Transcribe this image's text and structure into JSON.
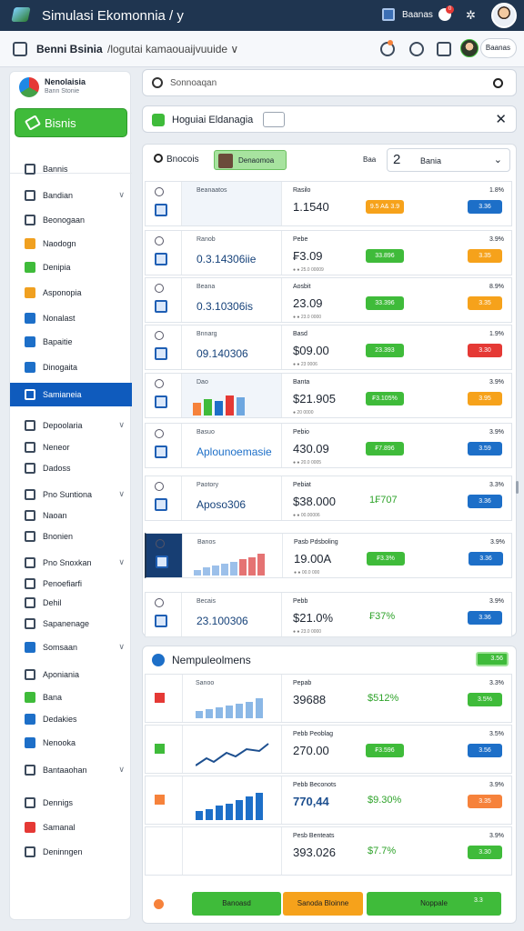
{
  "titlebar": {
    "title": "Simulasi Ekomonnia / y",
    "account_label": "Baanas",
    "badge_count": "0"
  },
  "toolbar": {
    "crumb_main": "Benni Bsinia",
    "crumb_path": "/logutai kamaouaijvuuide  ∨",
    "user_pill": "Baanas"
  },
  "sidebar": {
    "org_name": "Nenolaisia",
    "org_sub": "Bann Stonie",
    "primary_button": "Bisnis",
    "items": [
      {
        "label": "Bannis",
        "icon": "doc-icon",
        "color": "#3c4a5c"
      },
      {
        "label": "Bandian",
        "icon": "doc-icon",
        "color": "#3c4a5c",
        "chevron": "∨"
      },
      {
        "label": "Beonogaan",
        "icon": "doc-icon",
        "color": "#3c4a5c"
      },
      {
        "label": "Naodogn",
        "icon": "folder-icon",
        "color": "#f0a020"
      },
      {
        "label": "Denipia",
        "icon": "box-icon",
        "color": "#3fbb3a"
      },
      {
        "label": "Asponopia",
        "icon": "coin-icon",
        "color": "#f0a020"
      },
      {
        "label": "Nonalast",
        "icon": "check-icon",
        "color": "#1d6fc8"
      },
      {
        "label": "Bapaitie",
        "icon": "calendar-icon",
        "color": "#1d6fc8"
      },
      {
        "label": "Dinogaita",
        "icon": "edit-icon",
        "color": "#1d6fc8"
      },
      {
        "label": "Samianeia",
        "icon": "window-icon",
        "color": "#ffffff",
        "active": true
      },
      {
        "label": "Depoolaria",
        "icon": "doc-icon",
        "color": "#3c4a5c",
        "chevron": "∨"
      },
      {
        "label": "Neneor",
        "icon": "doc-icon",
        "color": "#3c4a5c"
      },
      {
        "label": "Dadoss",
        "icon": "doc-icon",
        "color": "#3c4a5c"
      },
      {
        "label": "Pno Suntiona",
        "icon": "doc-icon",
        "color": "#3c4a5c",
        "chevron": "∨"
      },
      {
        "label": "Naoan",
        "icon": "doc-icon",
        "color": "#3c4a5c"
      },
      {
        "label": "Bnonien",
        "icon": "chart-icon",
        "color": "#3c4a5c"
      },
      {
        "label": "Pno Snoxkan",
        "icon": "doc-icon",
        "color": "#3c4a5c",
        "chevron": "∨"
      },
      {
        "label": "Penoefiarfi",
        "icon": "doc-icon",
        "color": "#3c4a5c"
      },
      {
        "label": "Dehil",
        "icon": "doc-icon",
        "color": "#3c4a5c"
      },
      {
        "label": "Sapanenage",
        "icon": "doc-icon",
        "color": "#3c4a5c"
      },
      {
        "label": "Somsaan",
        "icon": "doc-icon",
        "color": "#1d6fc8",
        "chevron": "∨"
      },
      {
        "label": "Aponiania",
        "icon": "doc-icon",
        "color": "#3c4a5c"
      },
      {
        "label": "Bana",
        "icon": "chat-icon",
        "color": "#3fbb3a"
      },
      {
        "label": "Dedakies",
        "icon": "list-icon",
        "color": "#1d6fc8"
      },
      {
        "label": "Nenooka",
        "icon": "edit-icon",
        "color": "#1d6fc8"
      },
      {
        "label": "Bantaaohan",
        "icon": "image-icon",
        "color": "#3c4a5c",
        "chevron": "∨"
      },
      {
        "label": "Dennigs",
        "icon": "clock-icon",
        "color": "#3c4a5c"
      },
      {
        "label": "Samanal",
        "icon": "heart-icon",
        "color": "#e53935"
      },
      {
        "label": "Deninngen",
        "icon": "globe-icon",
        "color": "#3c4a5c"
      }
    ]
  },
  "search": {
    "placeholder": "Sonnoaqan"
  },
  "project_bar": {
    "title": "Hoguiai Eldanagia"
  },
  "panel": {
    "header_title": "Bnocois",
    "tag_label": "Denaomoa",
    "filter_label": "Baa",
    "select_number": "2",
    "select_value": "Bania",
    "rows": [
      {
        "label": "Beanaatos",
        "big": "",
        "big_color": "#16427a",
        "right_label": "Rasilo",
        "value": "1.1540",
        "dots": "",
        "chip": "9.5 A& 3.9",
        "chip_color": "#f6a21b",
        "pct": "1.8%",
        "badge": "3.36",
        "badge_color": "#1d6fc8"
      },
      {
        "label": "Ranob",
        "big": "0.3.14306iie",
        "big_color": "#16427a",
        "right_label": "Pebe",
        "value": "₣3.09",
        "dots": "● ● 25.0 00009",
        "chip": "33.896",
        "chip_color": "#3fbb3a",
        "pct": "3.9%",
        "badge": "3.35",
        "badge_color": "#f6a21b"
      },
      {
        "label": "Beana",
        "big": "0.3.10306is",
        "big_color": "#16427a",
        "right_label": "Aosbit",
        "value": "23.09",
        "dots": "● ● 23.0 0000",
        "chip": "33.396",
        "chip_color": "#3fbb3a",
        "pct": "8.9%",
        "badge": "3.35",
        "badge_color": "#f6a21b"
      },
      {
        "label": "Bnnarg",
        "big": "09.140306",
        "big_color": "#16427a",
        "right_label": "Basd",
        "value": "$09.00",
        "dots": "● ● 23 0006",
        "chip": "23.393",
        "chip_color": "#3fbb3a",
        "pct": "1.9%",
        "badge": "3.30",
        "badge_color": "#e53935"
      },
      {
        "label": "Dao",
        "big": "",
        "big_color": "#16427a",
        "right_label": "Banta",
        "value": "$21.905",
        "dots": "● 20 0000",
        "chip": "₣3.105%",
        "chip_color": "#3fbb3a",
        "pct": "3.9%",
        "badge": "3.95",
        "badge_color": "#f6a21b"
      },
      {
        "label": "Basuo",
        "big": "Aplounoemasie",
        "big_color": "#1d6fc8",
        "right_label": "Pebio",
        "value": "430.09",
        "dots": "● ● 20.0 0005",
        "chip": "₣7.896",
        "chip_color": "#3fbb3a",
        "pct": "3.9%",
        "badge": "3.59",
        "badge_color": "#1d6fc8"
      },
      {
        "label": "Paotory",
        "big": "Aposo306",
        "big_color": "#16427a",
        "right_label": "Pebiat",
        "value": "$38.000",
        "dots": "● ● 00.00006",
        "chip": "",
        "chip_color": "",
        "pct_text": "1₣707",
        "pct": "3.3%",
        "badge": "3.36",
        "badge_color": "#1d6fc8"
      },
      {
        "label": "Banos",
        "big": "",
        "big_color": "#16427a",
        "right_label": "Pasb Pdsboling",
        "value": "19.00A",
        "dots": "● ● 00.0 000",
        "chip": "₣3.3%",
        "chip_color": "#3fbb3a",
        "pct": "3.9%",
        "badge": "3.36",
        "badge_color": "#1d6fc8"
      },
      {
        "label": "Becais",
        "big": "23.100306",
        "big_color": "#16427a",
        "right_label": "Pebb",
        "value": "$21.0%",
        "dots": "● ● 23.0 0000",
        "chip": "",
        "chip_color": "",
        "pct_text": "₣37%",
        "pct": "3.9%",
        "badge": "3.36",
        "badge_color": "#1d6fc8"
      }
    ]
  },
  "section": {
    "title": "Nempuleolmens",
    "toggle": "3.56",
    "rows": [
      {
        "label": "Sanoo",
        "right_label": "Pepab",
        "value": "39688",
        "pct_text": "$512%",
        "pct": "3.3%",
        "badge": "3.5%",
        "badge_color": "#3fbb3a",
        "square": "#e53935"
      },
      {
        "label": "",
        "right_label": "Pebb Peoblag",
        "value": "270.00",
        "pct_text": "",
        "chip": "₣3.596",
        "pct": "3.5%",
        "badge": "3.56",
        "badge_color": "#1d6fc8",
        "square": "#3fbb3a"
      },
      {
        "label": "",
        "right_label": "Pebb Beconots",
        "value": "770,44",
        "pct_text": "$9.30%",
        "pct": "3.9%",
        "badge": "3.35",
        "badge_color": "#f6823b",
        "square": "#f6823b"
      },
      {
        "label": "",
        "right_label": "Pesb Benteats",
        "value": "393.026",
        "pct_text": "$7.7%",
        "pct": "3.9%",
        "badge": "3.30",
        "badge_color": "#3fbb3a",
        "square": ""
      }
    ],
    "actions": [
      {
        "label": "Banoasd",
        "color": "#3fbb3a"
      },
      {
        "label": "Sanoda Bloinne",
        "color": "#f6a21b"
      },
      {
        "label": "Noppale",
        "color": "#3fbb3a"
      }
    ],
    "action_badge": "3.3"
  },
  "colors": {
    "accent": "#1d6fc8",
    "success": "#3fbb3a",
    "warning": "#f6a21b",
    "danger": "#e53935",
    "titlebar": "#1f3550"
  }
}
